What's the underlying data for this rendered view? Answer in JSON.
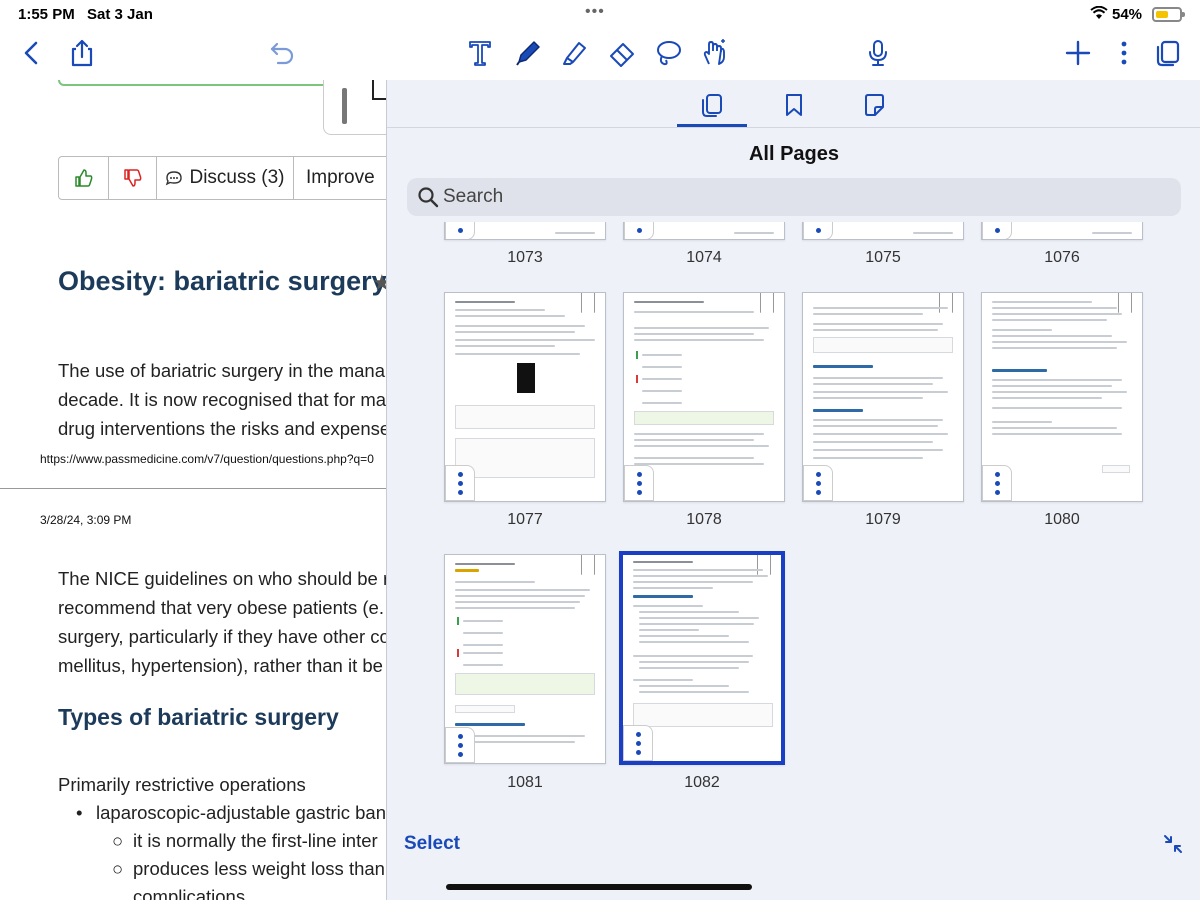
{
  "status_bar": {
    "time": "1:55 PM",
    "date": "Sat 3 Jan",
    "battery_percent": "54%",
    "battery_level": 0.54,
    "icons": [
      "wifi-icon",
      "battery-icon"
    ]
  },
  "toolbar": {
    "left_icons": [
      "back-chevron-icon",
      "share-icon",
      "undo-icon"
    ],
    "center_icons": [
      "text-tool-icon",
      "pen-tool-icon",
      "highlighter-icon",
      "eraser-icon",
      "lasso-icon",
      "hand-gesture-icon",
      "microphone-icon"
    ],
    "right_icons": [
      "add-icon",
      "more-icon",
      "pages-icon"
    ],
    "accent_color": "#1a4ab8"
  },
  "document": {
    "vote_bar": {
      "discuss_label": "Discuss (3)",
      "improve_label": "Improve"
    },
    "title": "Obesity: bariatric surgery",
    "intro_lines": [
      "The use of bariatric surgery in the mana",
      "decade. It is now recognised that for ma",
      "drug interventions the risks and expense"
    ],
    "url": "https://www.passmedicine.com/v7/question/questions.php?q=0",
    "printed_date": "3/28/24, 3:09 PM",
    "nice_lines": [
      "The NICE guidelines on who should be r",
      "recommend that very obese patients (e.",
      "surgery, particularly if they have other co",
      "mellitus, hypertension), rather than it be"
    ],
    "types_heading": "Types of bariatric surgery",
    "restrictive_heading": "Primarily restrictive operations",
    "bullet_1": "laparoscopic-adjustable gastric ban",
    "sub_bullet_1": "it is normally the first-line inter",
    "sub_bullet_2": "produces less weight loss than",
    "sub_bullet_3": "complications"
  },
  "pages_panel": {
    "tabs": [
      "all-pages-tab",
      "bookmarks-tab",
      "annotations-tab"
    ],
    "active_tab": "all-pages-tab",
    "title": "All Pages",
    "search_placeholder": "Search",
    "row_partial": [
      "1073",
      "1074",
      "1075",
      "1076"
    ],
    "row_2": [
      "1077",
      "1078",
      "1079",
      "1080"
    ],
    "row_3": [
      "1081",
      "1082"
    ],
    "selected_page": "1082",
    "select_label": "Select"
  }
}
